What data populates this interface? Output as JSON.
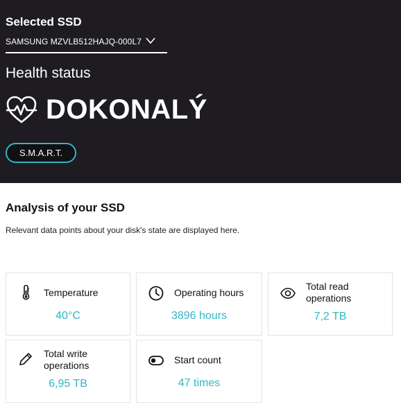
{
  "header": {
    "selected_label": "Selected SSD",
    "ssd_model": "SAMSUNG MZVLB512HAJQ-000L7",
    "health_label": "Health status",
    "health_status": "DOKONALÝ",
    "smart_button": "S.M.A.R.T."
  },
  "analysis": {
    "title": "Analysis of your SSD",
    "description": "Relevant data points about your disk's state are displayed here."
  },
  "cards": [
    {
      "icon": "thermometer-icon",
      "title": "Temperature",
      "value": "40°C"
    },
    {
      "icon": "clock-icon",
      "title": "Operating hours",
      "value": "3896 hours"
    },
    {
      "icon": "eye-icon",
      "title_line1": "Total read",
      "title_line2": "operations",
      "value": "7,2 TB"
    },
    {
      "icon": "pencil-icon",
      "title_line1": "Total write",
      "title_line2": "operations",
      "value": "6,95 TB"
    },
    {
      "icon": "toggle-icon",
      "title": "Start count",
      "value": "47 times"
    }
  ],
  "colors": {
    "header_bg": "#1e1c21",
    "accent": "#2fb7c4"
  }
}
